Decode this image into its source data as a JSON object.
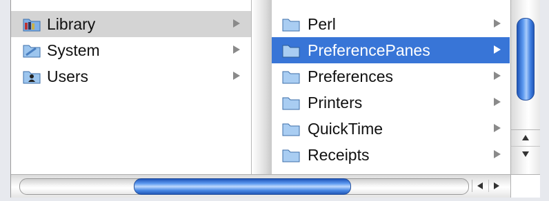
{
  "column1": {
    "items": [
      {
        "label": "Library",
        "icon": "library-folder-icon",
        "state": "selected-inactive"
      },
      {
        "label": "System",
        "icon": "system-folder-icon",
        "state": "normal"
      },
      {
        "label": "Users",
        "icon": "users-folder-icon",
        "state": "normal"
      }
    ]
  },
  "column2": {
    "items": [
      {
        "label": "Perl",
        "icon": "folder-icon",
        "state": "normal"
      },
      {
        "label": "PreferencePanes",
        "icon": "folder-icon",
        "state": "selected"
      },
      {
        "label": "Preferences",
        "icon": "folder-icon",
        "state": "normal"
      },
      {
        "label": "Printers",
        "icon": "folder-icon",
        "state": "normal"
      },
      {
        "label": "QuickTime",
        "icon": "folder-icon",
        "state": "normal"
      },
      {
        "label": "Receipts",
        "icon": "folder-icon",
        "state": "normal"
      }
    ]
  },
  "colors": {
    "selection_blue": "#3875d7",
    "selection_gray": "#d4d4d4",
    "scroll_thumb_blue": "#3f7ee0"
  }
}
